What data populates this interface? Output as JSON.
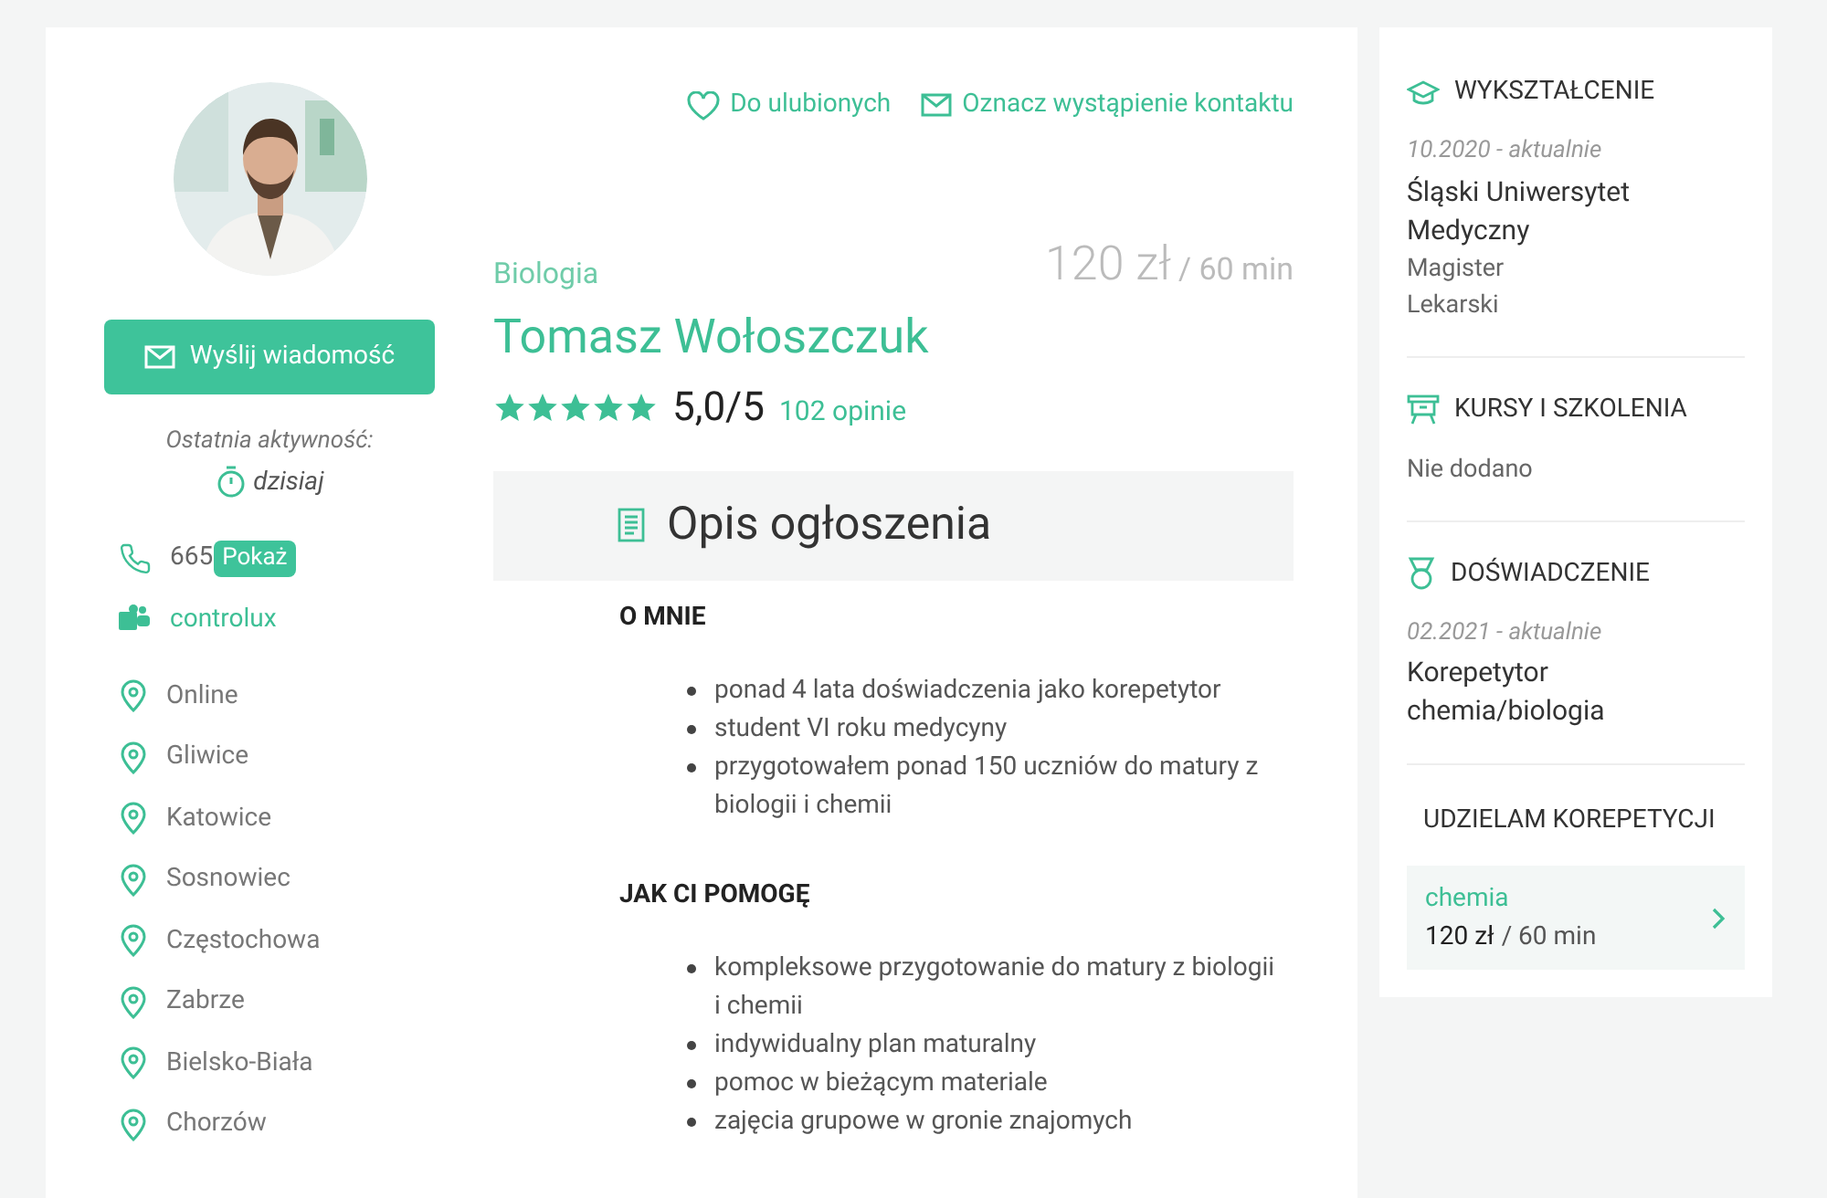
{
  "actions": {
    "favorite": "Do ulubionych",
    "mark_contact": "Oznacz wystąpienie kontaktu"
  },
  "profile": {
    "send_button": "Wyślij wiadomość",
    "last_activity_label": "Ostatnia aktywność:",
    "last_activity": "dzisiaj",
    "phone": "665",
    "show_phone": "Pokaż",
    "teams": "controlux",
    "locations": [
      "Online",
      "Gliwice",
      "Katowice",
      "Sosnowiec",
      "Częstochowa",
      "Zabrze",
      "Bielsko-Biała",
      "Chorzów"
    ]
  },
  "listing": {
    "subject": "Biologia",
    "name": "Tomasz Wołoszczuk",
    "price": "120 zł",
    "price_unit": "/ 60 min",
    "stars": 5,
    "rating": "5,0/5",
    "reviews": "102 opinie"
  },
  "description": {
    "title": "Opis ogłoszenia",
    "sections": [
      {
        "heading": "O MNIE",
        "items": [
          "ponad 4 lata doświadczenia jako korepetytor",
          "student VI roku medycyny",
          "przygotowałem ponad 150 uczniów do matury z biologii i chemii"
        ]
      },
      {
        "heading": "JAK CI POMOGĘ",
        "items": [
          "kompleksowe przygotowanie do matury z biologii i chemii",
          "indywidualny plan maturalny",
          "pomoc w bieżącym materiale",
          "zajęcia grupowe w gronie znajomych"
        ]
      }
    ]
  },
  "sidebar": {
    "sections": [
      {
        "kind": "education",
        "title": "WYKSZTAŁCENIE",
        "period": "10.2020 - aktualnie",
        "main": "Śląski Uniwersytet Medyczny",
        "details": [
          "Magister",
          "Lekarski"
        ]
      },
      {
        "kind": "courses",
        "title": "KURSY I SZKOLENIA",
        "details": [
          "Nie dodano"
        ]
      },
      {
        "kind": "experience",
        "title": "DOŚWIADCZENIE",
        "period": "02.2021 - aktualnie",
        "main": "Korepetytor chemia/biologia"
      }
    ],
    "tutoring_title": "UDZIELAM KOREPETYCJI",
    "subjects": [
      {
        "name": "chemia",
        "price": "120 zł",
        "unit": "/ 60 min"
      }
    ]
  }
}
